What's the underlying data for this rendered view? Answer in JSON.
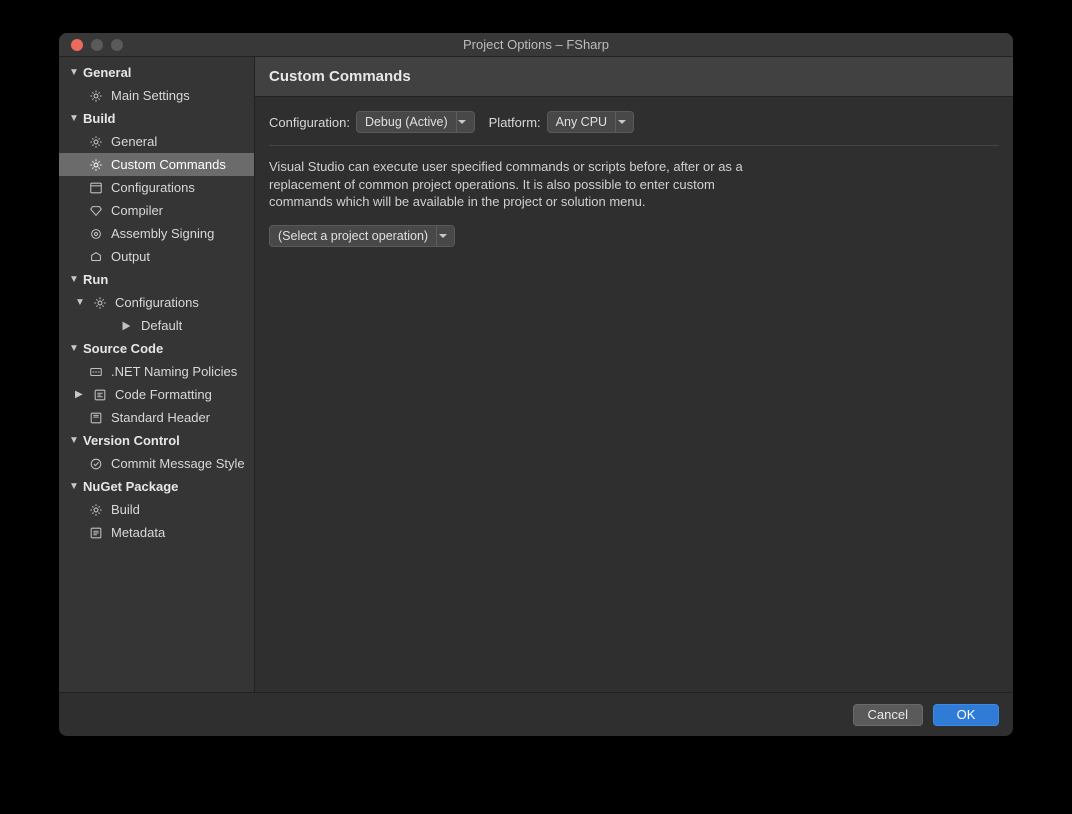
{
  "window_title": "Project Options – FSharp",
  "sidebar": {
    "general": {
      "label": "General",
      "main_settings": "Main Settings"
    },
    "build": {
      "label": "Build",
      "general": "General",
      "custom_commands": "Custom Commands",
      "configurations": "Configurations",
      "compiler": "Compiler",
      "assembly_signing": "Assembly Signing",
      "output": "Output"
    },
    "run": {
      "label": "Run",
      "configurations": "Configurations",
      "default": "Default"
    },
    "source_code": {
      "label": "Source Code",
      "naming": ".NET Naming Policies",
      "formatting": "Code Formatting",
      "std_header": "Standard Header"
    },
    "version_control": {
      "label": "Version Control",
      "commit_msg": "Commit Message Style"
    },
    "nuget": {
      "label": "NuGet Package",
      "build": "Build",
      "metadata": "Metadata"
    }
  },
  "main": {
    "heading": "Custom Commands",
    "config_label": "Configuration:",
    "config_value": "Debug (Active)",
    "platform_label": "Platform:",
    "platform_value": "Any CPU",
    "description": "Visual Studio can execute user specified commands or scripts before, after or as a replacement of common project operations. It is also possible to enter custom commands which will be available in the project or solution menu.",
    "operation_select": "(Select a project operation)"
  },
  "footer": {
    "cancel": "Cancel",
    "ok": "OK"
  }
}
